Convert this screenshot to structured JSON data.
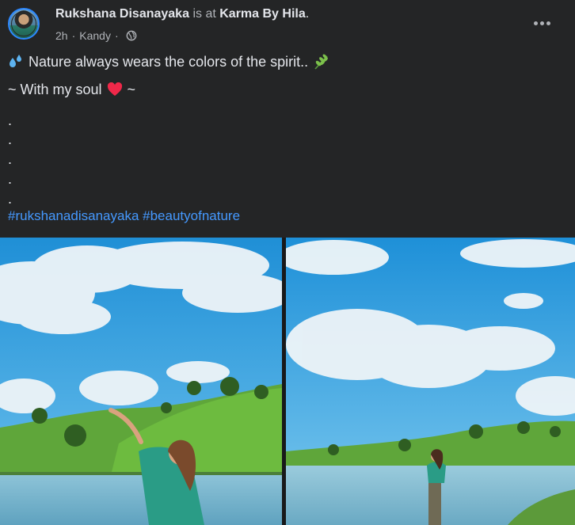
{
  "post": {
    "author": "Rukshana Disanayaka",
    "at_text": "is at",
    "place": "Karma By Hila",
    "trailing_dot": ".",
    "time": "2h",
    "separator": "·",
    "location": "Kandy",
    "privacy_icon": "globe-icon",
    "more_icon": "more-horizontal-icon",
    "text": {
      "line1": "Nature always wears the colors of the spirit..",
      "line2_prefix": "~ With my soul",
      "line2_suffix": "~",
      "dots": [
        ".",
        ".",
        ".",
        ".",
        "."
      ],
      "hashtags": [
        "#rukshanadisanayaka",
        "#beautyofnature"
      ]
    },
    "emoji": {
      "droplets": "sweat-droplets-icon",
      "herb": "herb-icon",
      "heart": "red-heart-icon"
    },
    "photos": [
      {
        "description_icon": "photo-lake-left"
      },
      {
        "description_icon": "photo-lake-right"
      }
    ],
    "colors": {
      "background": "#242526",
      "link": "#4599ff",
      "secondary_text": "#b0b3b8",
      "avatar_ring": "#2d88ff",
      "heart": "#f02849"
    }
  }
}
